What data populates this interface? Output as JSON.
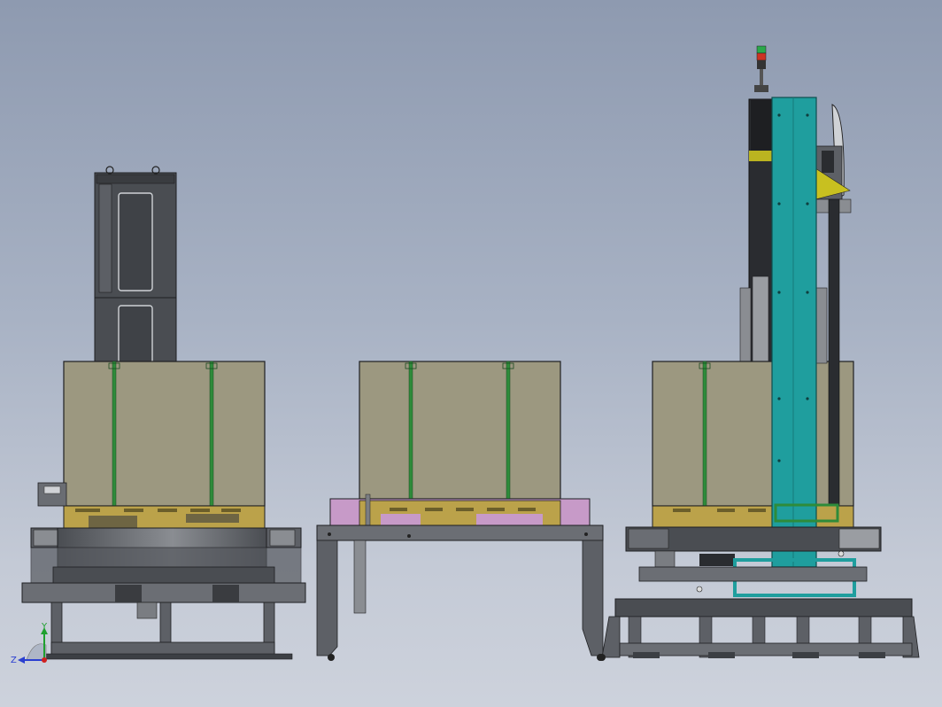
{
  "view": {
    "background_top": "#8e9ab0",
    "background_bottom": "#cdd2dc"
  },
  "colors": {
    "box": "#9c9880",
    "strap": "#2e8b3a",
    "pallet": "#bba24a",
    "frame": "#5d6066",
    "frame_dark": "#3c3f44",
    "teal_column": "#1f9e9e",
    "pink_pallet": "#c79ac8",
    "cabinet": "#4a4d52",
    "yellow_bracket": "#c8c020"
  },
  "axes_triad": {
    "x_label": "",
    "y_label": "Y",
    "z_label": "Z"
  }
}
